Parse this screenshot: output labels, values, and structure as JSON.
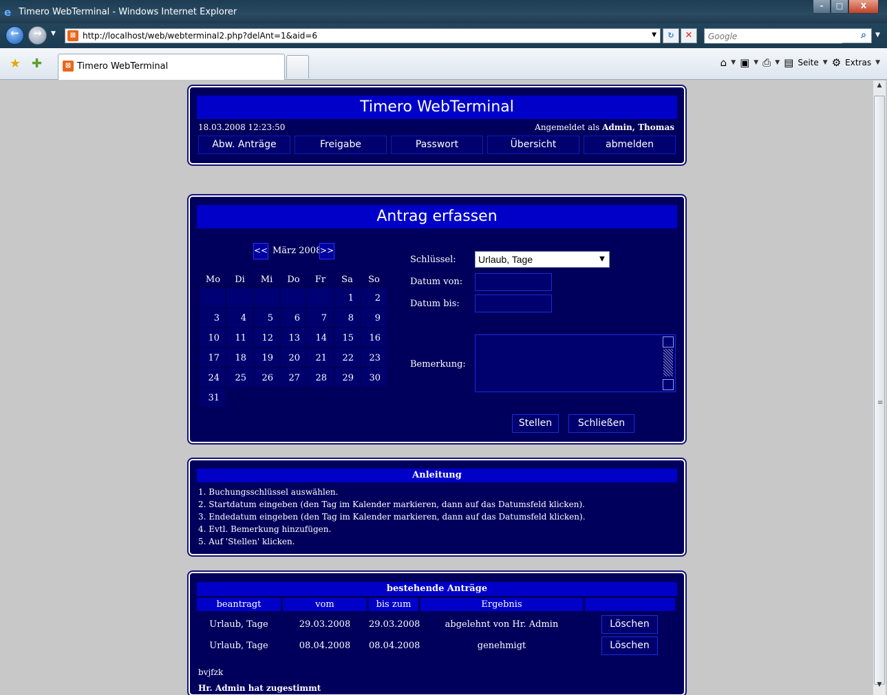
{
  "browser": {
    "window_title": "Timero WebTerminal - Windows Internet Explorer",
    "url": "http://localhost/web/webterminal2.php?delAnt=1&aid=6",
    "search_placeholder": "Google",
    "tab_title": "Timero WebTerminal",
    "cmd_page": "Seite",
    "cmd_extras": "Extras"
  },
  "header": {
    "title": "Timero WebTerminal",
    "datetime": "18.03.2008 12:23:50",
    "logged_in_prefix": "Angemeldet als",
    "logged_in_user": "Admin, Thomas",
    "nav": [
      "Abw. Anträge",
      "Freigabe",
      "Passwort",
      "Übersicht",
      "abmelden"
    ]
  },
  "form": {
    "title": "Antrag erfassen",
    "calendar": {
      "month_label": "März 2008",
      "prev": "<<",
      "next": ">>",
      "weekdays": [
        "Mo",
        "Di",
        "Mi",
        "Do",
        "Fr",
        "Sa",
        "So"
      ],
      "weeks": [
        [
          "",
          "",
          "",
          "",
          "",
          "1",
          "2"
        ],
        [
          "3",
          "4",
          "5",
          "6",
          "7",
          "8",
          "9"
        ],
        [
          "10",
          "11",
          "12",
          "13",
          "14",
          "15",
          "16"
        ],
        [
          "17",
          "18",
          "19",
          "20",
          "21",
          "22",
          "23"
        ],
        [
          "24",
          "25",
          "26",
          "27",
          "28",
          "29",
          "30"
        ],
        [
          "31"
        ]
      ]
    },
    "key_label": "Schlüssel:",
    "key_value": "Urlaub, Tage",
    "date_from_label": "Datum von:",
    "date_to_label": "Datum bis:",
    "remark_label": "Bemerkung:",
    "submit": "Stellen",
    "close": "Schließen"
  },
  "help": {
    "title": "Anleitung",
    "steps": [
      "1. Buchungsschlüssel auswählen.",
      "2. Startdatum eingeben (den Tag im Kalender markieren, dann auf das Datumsfeld klicken).",
      "3. Endedatum eingeben (den Tag im Kalender markieren, dann auf das Datumsfeld klicken).",
      "4. Evtl. Bemerkung hinzufügen.",
      "5. Auf 'Stellen' klicken."
    ]
  },
  "requests": {
    "title": "bestehende Anträge",
    "columns": [
      "beantragt",
      "vom",
      "bis zum",
      "Ergebnis",
      ""
    ],
    "rows": [
      {
        "type": "Urlaub, Tage",
        "from": "29.03.2008",
        "to": "29.03.2008",
        "result": "abgelehnt von Hr. Admin",
        "action": "Löschen"
      },
      {
        "type": "Urlaub, Tage",
        "from": "08.04.2008",
        "to": "08.04.2008",
        "result": "genehmigt",
        "action": "Löschen"
      }
    ],
    "note_remark": "bvjfzk",
    "note_approval": "Hr. Admin hat zugestimmt"
  }
}
